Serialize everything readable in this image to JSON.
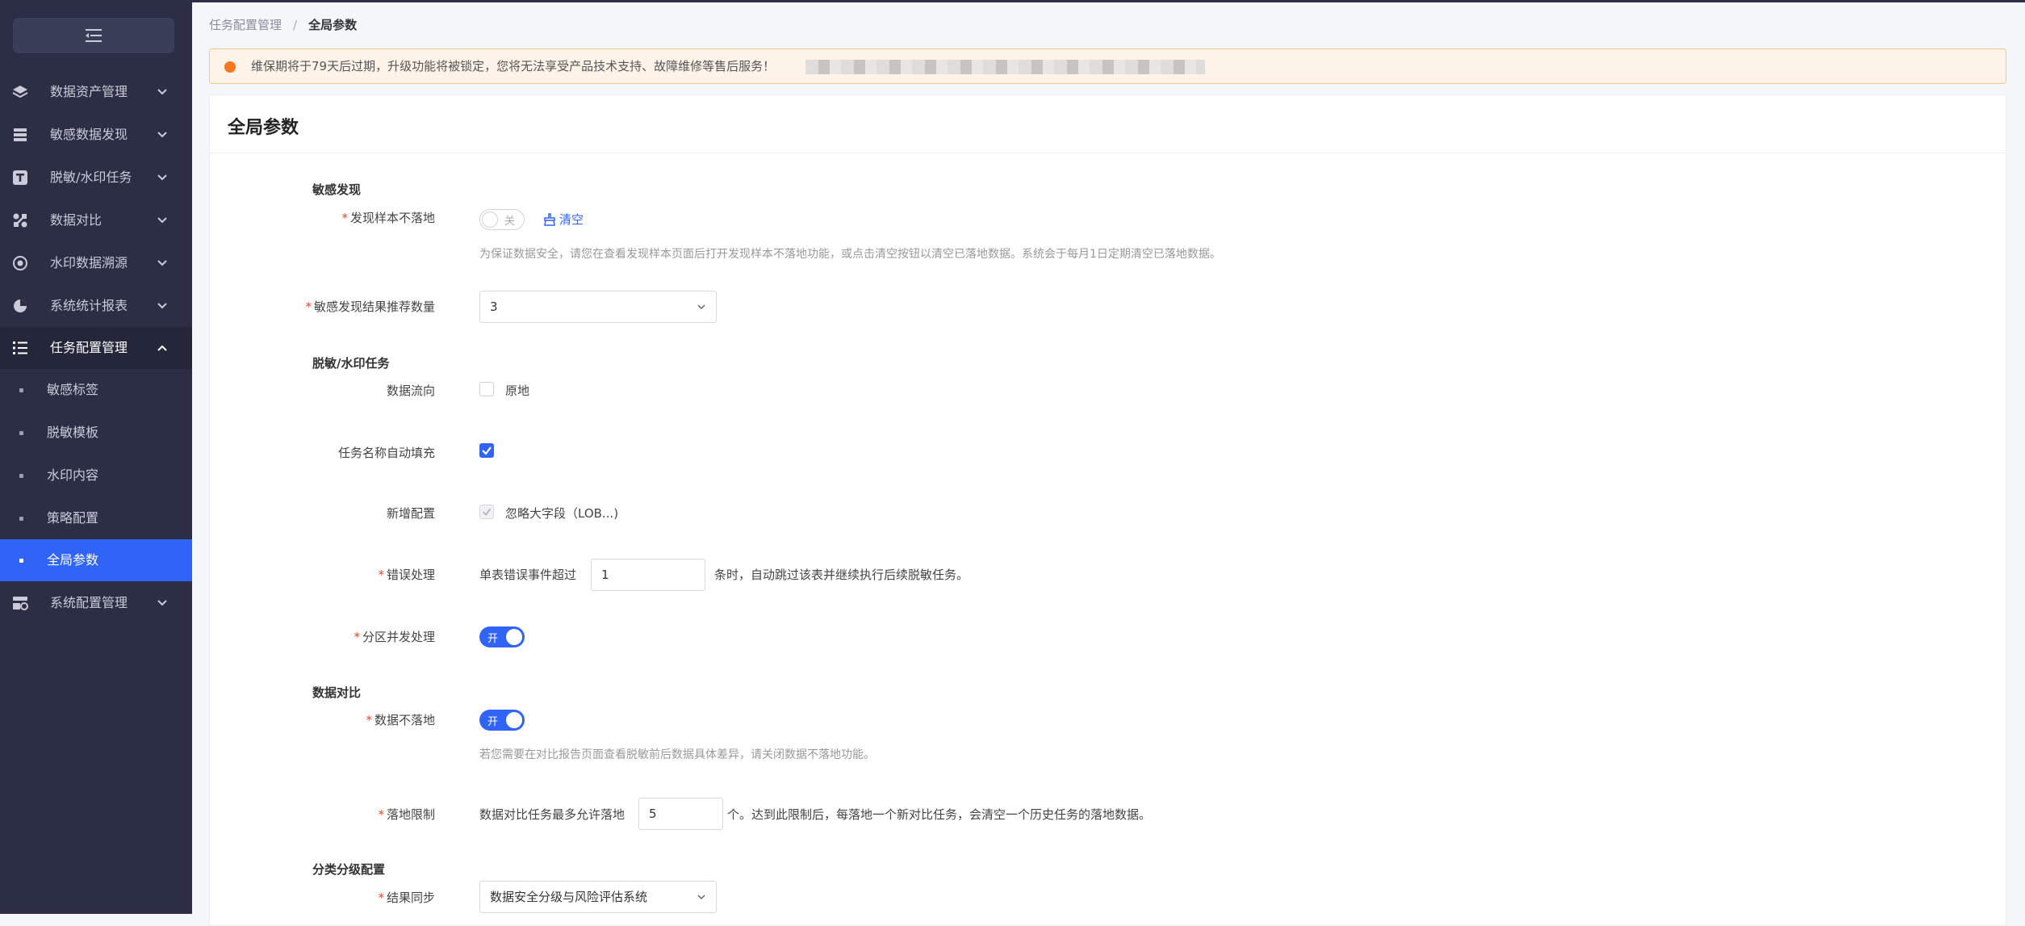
{
  "sidebar": {
    "collapse_icon": "menu-fold-icon",
    "items": [
      {
        "label": "数据资产管理",
        "icon": "layers-icon"
      },
      {
        "label": "敏感数据发现",
        "icon": "database-list-icon"
      },
      {
        "label": "脱敏/水印任务",
        "icon": "text-t-icon"
      },
      {
        "label": "数据对比",
        "icon": "compare-icon"
      },
      {
        "label": "水印数据溯源",
        "icon": "target-icon"
      },
      {
        "label": "系统统计报表",
        "icon": "pie-chart-icon"
      },
      {
        "label": "任务配置管理",
        "icon": "task-list-icon"
      },
      {
        "label": "系统配置管理",
        "icon": "settings-panel-icon"
      }
    ],
    "sub_items": [
      {
        "label": "敏感标签"
      },
      {
        "label": "脱敏模板"
      },
      {
        "label": "水印内容"
      },
      {
        "label": "策略配置"
      },
      {
        "label": "全局参数"
      }
    ]
  },
  "breadcrumb": {
    "parent": "任务配置管理",
    "separator": "/",
    "current": "全局参数"
  },
  "banner": {
    "text": "维保期将于79天后过期，升级功能将被锁定，您将无法享受产品技术支持、故障维修等售后服务！",
    "color": "#f5781f"
  },
  "panel": {
    "title": "全局参数"
  },
  "sensitive": {
    "section": "敏感发现",
    "sample_label": "发现样本不落地",
    "sample_switch": "关",
    "clear_label": "清空",
    "sample_help": "为保证数据安全，请您在查看发现样本页面后打开发现样本不落地功能，或点击清空按钮以清空已落地数据。系统会于每月1日定期清空已落地数据。",
    "recommend_label": "敏感发现结果推荐数量",
    "recommend_value": "3"
  },
  "mask": {
    "section": "脱敏/水印任务",
    "flow_label": "数据流向",
    "flow_option": "原地",
    "autofill_label": "任务名称自动填充",
    "newcfg_label": "新增配置",
    "newcfg_option": "忽略大字段（LOB...)",
    "error_label": "错误处理",
    "error_prefix": "单表错误事件超过",
    "error_value": "1",
    "error_suffix": "条时，自动跳过该表并继续执行后续脱敏任务。",
    "partition_label": "分区并发处理",
    "partition_switch": "开"
  },
  "compare": {
    "section": "数据对比",
    "noland_label": "数据不落地",
    "noland_switch": "开",
    "noland_help": "若您需要在对比报告页面查看脱敏前后数据具体差异，请关闭数据不落地功能。",
    "limit_label": "落地限制",
    "limit_prefix": "数据对比任务最多允许落地",
    "limit_value": "5",
    "limit_suffix": "个。达到此限制后，每落地一个新对比任务，会清空一个历史任务的落地数据。"
  },
  "classify": {
    "section": "分类分级配置",
    "sync_label": "结果同步",
    "sync_value": "数据安全分级与风险评估系统"
  },
  "colors": {
    "accent": "#2f64f6",
    "sidebar": "#2b2e44",
    "required": "#f0462d",
    "warning": "#f5781f"
  }
}
